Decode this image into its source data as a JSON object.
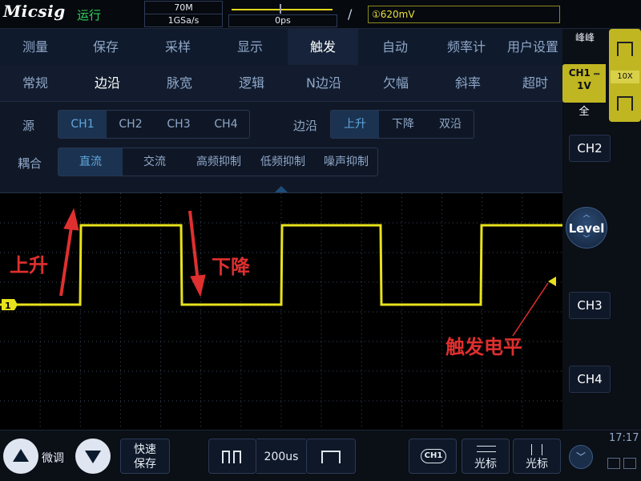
{
  "header": {
    "brand": "Micsig",
    "run_status": "运行",
    "bandwidth": "70M",
    "sample_rate": "1GSa/s",
    "time_offset": "0ps",
    "trigger_level": "①620mV"
  },
  "menu": {
    "main_tabs": [
      "测量",
      "保存",
      "采样",
      "显示",
      "触发",
      "自动",
      "频率计",
      "用户设置"
    ],
    "active_main": 4,
    "sub_tabs": [
      "常规",
      "边沿",
      "脉宽",
      "逻辑",
      "N边沿",
      "欠幅",
      "斜率",
      "超时"
    ],
    "active_sub": 1,
    "source_label": "源",
    "source_options": [
      "CH1",
      "CH2",
      "CH3",
      "CH4"
    ],
    "edge_label": "边沿",
    "edge_options": [
      "上升",
      "下降",
      "双沿"
    ],
    "coupling_label": "耦合",
    "coupling_options": [
      "直流",
      "交流",
      "高频抑制",
      "低频抑制",
      "噪声抑制"
    ]
  },
  "scope": {
    "channel_marker": "1",
    "annotations": {
      "rising": "上升",
      "falling": "下降",
      "trigger_level": "触发电平"
    },
    "colors": {
      "trace": "#e8e21c",
      "annotation": "#e02f2f",
      "grid": "#3a4a60"
    }
  },
  "right_panel": {
    "measure": "峰峰",
    "ch1_label": "CH1",
    "ch1_coupling": "⎓",
    "ch1_scale": "1V",
    "ch1_bw": "全",
    "probe": "10X",
    "ch2": "CH2",
    "level": "Level",
    "ch3": "CH3",
    "ch4": "CH4"
  },
  "bottom": {
    "fine": "微调",
    "quick_save_1": "快速",
    "quick_save_2": "保存",
    "timebase": "200us",
    "ch1_tag": "CH1",
    "cursor_h": "光标",
    "cursor_v": "光标",
    "time": "17:17"
  }
}
